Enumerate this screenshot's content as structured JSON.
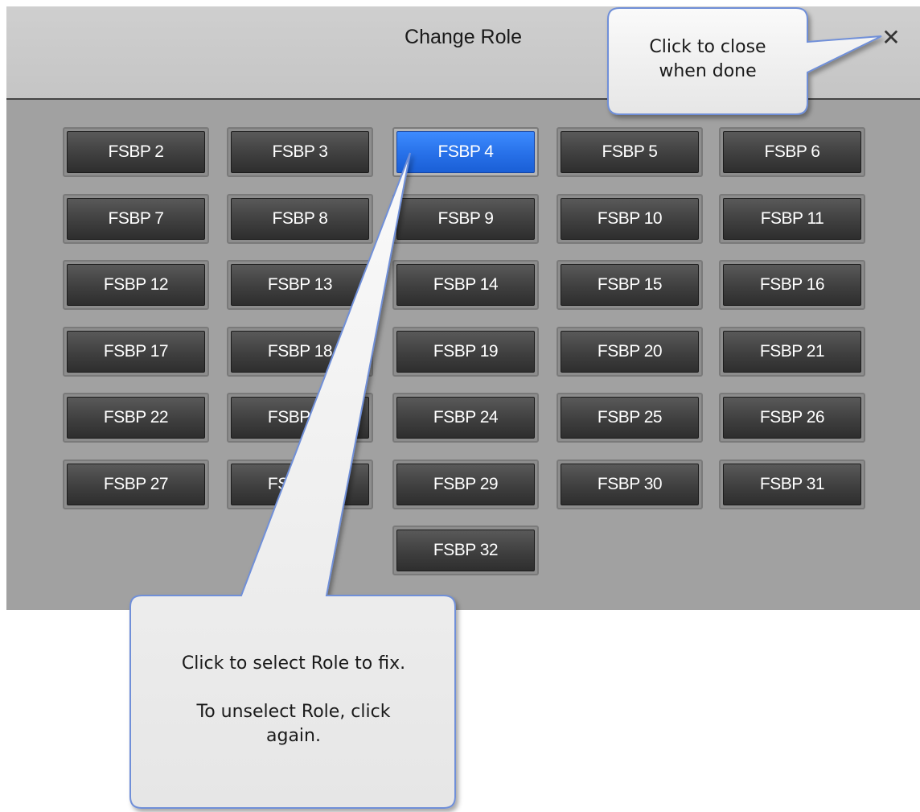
{
  "dialog": {
    "title": "Change Role",
    "close_icon": "close-icon",
    "close_glyph": "✕"
  },
  "roles": [
    "FSBP 2",
    "FSBP 3",
    "FSBP 4",
    "FSBP 5",
    "FSBP 6",
    "FSBP 7",
    "FSBP 8",
    "FSBP 9",
    "FSBP 10",
    "FSBP 11",
    "FSBP 12",
    "FSBP 13",
    "FSBP 14",
    "FSBP 15",
    "FSBP 16",
    "FSBP 17",
    "FSBP 18",
    "FSBP 19",
    "FSBP 20",
    "FSBP 21",
    "FSBP 22",
    "FSBP 23",
    "FSBP 24",
    "FSBP 25",
    "FSBP 26",
    "FSBP 27",
    "FSBP 28",
    "FSBP 29",
    "FSBP 30",
    "FSBP 31",
    "FSBP 32"
  ],
  "selected_role": "FSBP 4",
  "callouts": {
    "close": {
      "line1": "Click to close",
      "line2": "when done"
    },
    "select": {
      "line1": "Click to select Role to fix.",
      "line2": "To unselect Role, click",
      "line3": "again."
    }
  },
  "colors": {
    "dialog_bg": "#a1a1a1",
    "header_bg": "#c8c8c8",
    "button_face": "#3f3f3f",
    "selected_button": "#2770e8",
    "callout_fill": "#eeeeee",
    "callout_border": "#6f8fd8"
  }
}
